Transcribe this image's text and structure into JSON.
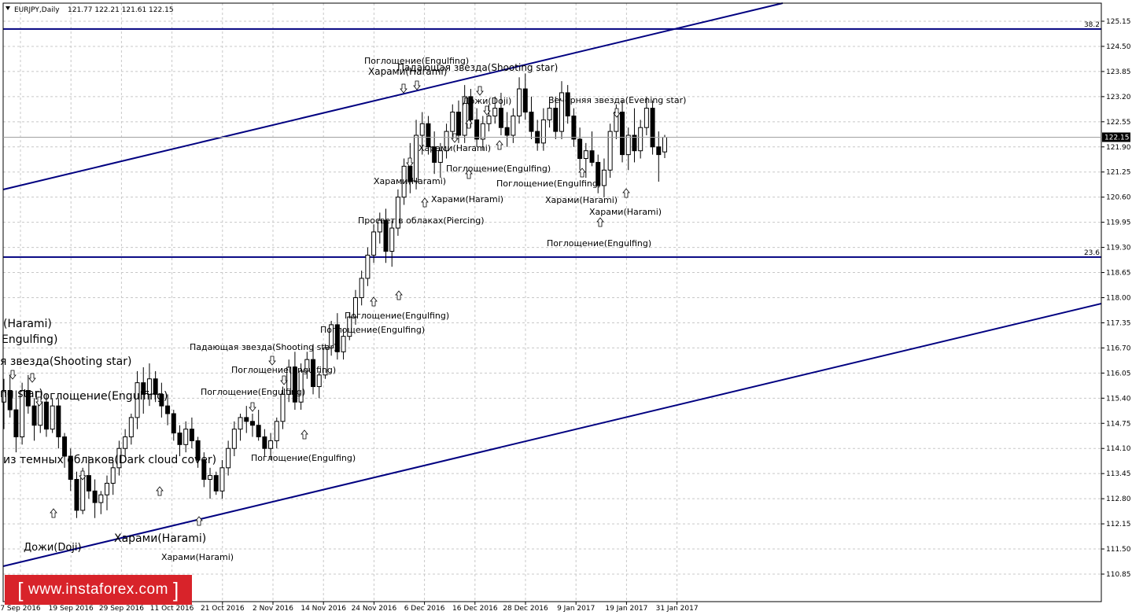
{
  "header": {
    "symbol": "EURJPY,Daily",
    "ohlc": "121.77 122.21 121.61 122.15"
  },
  "price_axis": {
    "ticks": [
      "125.15",
      "124.50",
      "123.85",
      "123.20",
      "122.55",
      "121.90",
      "121.25",
      "120.60",
      "119.95",
      "119.30",
      "118.65",
      "118.00",
      "117.35",
      "116.70",
      "116.05",
      "115.40",
      "114.75",
      "114.10",
      "113.45",
      "112.80",
      "112.15",
      "111.50",
      "110.85"
    ],
    "current_price": "122.15"
  },
  "time_axis": {
    "labels": [
      "7 Sep 2016",
      "19 Sep 2016",
      "29 Sep 2016",
      "11 Oct 2016",
      "21 Oct 2016",
      "2 Nov 2016",
      "14 Nov 2016",
      "24 Nov 2016",
      "6 Dec 2016",
      "16 Dec 2016",
      "28 Dec 2016",
      "9 Jan 2017",
      "19 Jan 2017",
      "31 Jan 2017"
    ]
  },
  "levels": [
    {
      "label": "38.2",
      "price": 124.95
    },
    {
      "label": "23.6",
      "price": 119.05
    }
  ],
  "pattern_labels": [
    "Поглощение(Engulfing)",
    "Падающая звезда(Shooting star)",
    "Харами(Harami)",
    "Дожи(Doji)",
    "Вечерняя звезда(Evening star)",
    "Харами(Harami)",
    "Поглощение(Engulfing)",
    "Харами(Harami)",
    "Поглощение(Engulfing)",
    "Харами(Harami)",
    "Харами(Harami)",
    "Просвет в облаках(Piercing)",
    "Харами(Harami)",
    "Поглощение(Engulfing)",
    "Поглощение(Engulfing)",
    "Поглощение(Engulfing)",
    "Падающая звезда(Shooting star)",
    "Поглощение(Engulfing)",
    "Поглощение(Engulfing)",
    "Поглощение(Engulfing)",
    "Харами(Harami)",
    "Харами(Harami)",
    "Дожи(Doji)",
    "из темных облаков(Dark cloud cover)",
    "Поглощение(Engulfing)",
    "ng star)",
    "я звезда(Shooting star)",
    "Engulfing)",
    "(Harami)"
  ],
  "watermark": {
    "text": "www.instaforex.com",
    "open": "[",
    "close": "]"
  },
  "colors": {
    "trend_line": "#000080",
    "bull_body": "#ffffff",
    "bear_body": "#000000",
    "grid": "#c8c8c8"
  },
  "chart_data": {
    "type": "candlestick",
    "symbol": "EURJPY",
    "timeframe": "Daily",
    "ylim": [
      110.6,
      125.5
    ],
    "x": [
      "7 Sep 2016",
      "19 Sep 2016",
      "29 Sep 2016",
      "11 Oct 2016",
      "21 Oct 2016",
      "2 Nov 2016",
      "14 Nov 2016",
      "24 Nov 2016",
      "6 Dec 2016",
      "16 Dec 2016",
      "28 Dec 2016",
      "9 Jan 2017",
      "19 Jan 2017",
      "31 Jan 2017"
    ],
    "series": [
      {
        "name": "EURJPY,Daily",
        "values": [
          [
            115.3,
            115.9,
            114.6,
            115.6
          ],
          [
            115.6,
            116.0,
            114.9,
            115.1
          ],
          [
            115.1,
            115.6,
            114.0,
            114.4
          ],
          [
            114.4,
            115.8,
            114.2,
            115.6
          ],
          [
            115.6,
            116.0,
            115.0,
            115.2
          ],
          [
            115.2,
            115.4,
            114.3,
            114.7
          ],
          [
            114.7,
            115.4,
            114.5,
            115.3
          ],
          [
            115.3,
            115.5,
            114.4,
            114.6
          ],
          [
            114.6,
            115.4,
            114.5,
            115.2
          ],
          [
            115.2,
            115.4,
            114.1,
            114.4
          ],
          [
            114.4,
            114.5,
            113.6,
            113.9
          ],
          [
            113.9,
            114.1,
            113.0,
            113.3
          ],
          [
            113.3,
            113.5,
            112.3,
            112.5
          ],
          [
            112.5,
            113.6,
            112.4,
            113.4
          ],
          [
            113.4,
            113.9,
            112.8,
            113.0
          ],
          [
            113.0,
            113.3,
            112.3,
            112.7
          ],
          [
            112.7,
            113.0,
            112.4,
            112.9
          ],
          [
            112.9,
            113.4,
            112.5,
            113.2
          ],
          [
            113.2,
            113.8,
            112.9,
            113.6
          ],
          [
            113.6,
            114.3,
            113.4,
            114.1
          ],
          [
            114.1,
            114.6,
            113.9,
            114.4
          ],
          [
            114.4,
            115.0,
            114.2,
            114.9
          ],
          [
            114.9,
            116.1,
            114.6,
            115.8
          ],
          [
            115.8,
            116.2,
            115.0,
            115.5
          ],
          [
            115.5,
            116.3,
            115.2,
            115.9
          ],
          [
            115.9,
            116.1,
            115.3,
            115.5
          ],
          [
            115.5,
            115.8,
            114.9,
            115.2
          ],
          [
            115.2,
            115.5,
            114.7,
            115.0
          ],
          [
            115.0,
            115.1,
            114.3,
            114.5
          ],
          [
            114.5,
            114.7,
            113.9,
            114.2
          ],
          [
            114.2,
            114.8,
            114.0,
            114.6
          ],
          [
            114.6,
            114.9,
            114.1,
            114.3
          ],
          [
            114.3,
            114.4,
            113.6,
            113.8
          ],
          [
            113.8,
            114.0,
            113.1,
            113.3
          ],
          [
            113.3,
            113.6,
            112.8,
            113.4
          ],
          [
            113.4,
            113.5,
            112.9,
            113.0
          ],
          [
            113.0,
            113.8,
            112.8,
            113.6
          ],
          [
            113.6,
            114.3,
            113.4,
            114.1
          ],
          [
            114.1,
            114.8,
            113.9,
            114.6
          ],
          [
            114.6,
            115.0,
            114.3,
            114.9
          ],
          [
            114.9,
            115.2,
            114.5,
            114.8
          ],
          [
            114.8,
            115.0,
            114.4,
            114.7
          ],
          [
            114.7,
            115.1,
            114.3,
            114.4
          ],
          [
            114.4,
            114.6,
            113.9,
            114.1
          ],
          [
            114.1,
            114.5,
            113.8,
            114.3
          ],
          [
            114.3,
            114.9,
            114.1,
            114.8
          ],
          [
            114.8,
            115.7,
            114.6,
            115.5
          ],
          [
            115.5,
            116.4,
            115.3,
            116.2
          ],
          [
            116.2,
            116.6,
            115.1,
            115.3
          ],
          [
            115.3,
            116.3,
            115.1,
            116.1
          ],
          [
            116.1,
            116.6,
            115.9,
            116.4
          ],
          [
            116.4,
            116.8,
            115.5,
            115.7
          ],
          [
            115.7,
            116.1,
            115.4,
            116.0
          ],
          [
            116.0,
            116.8,
            115.9,
            116.7
          ],
          [
            116.7,
            117.4,
            116.5,
            117.3
          ],
          [
            117.3,
            117.6,
            116.4,
            116.6
          ],
          [
            116.6,
            117.2,
            116.4,
            117.0
          ],
          [
            117.0,
            117.6,
            116.9,
            117.5
          ],
          [
            117.5,
            118.2,
            117.3,
            118.0
          ],
          [
            118.0,
            118.7,
            117.8,
            118.5
          ],
          [
            118.5,
            119.3,
            118.3,
            119.1
          ],
          [
            119.1,
            119.9,
            118.9,
            119.7
          ],
          [
            119.7,
            120.2,
            119.4,
            120.0
          ],
          [
            120.0,
            120.3,
            118.9,
            119.2
          ],
          [
            119.2,
            120.0,
            118.8,
            119.8
          ],
          [
            119.8,
            120.8,
            119.6,
            120.6
          ],
          [
            120.6,
            121.6,
            120.4,
            121.4
          ],
          [
            121.4,
            122.0,
            120.7,
            121.0
          ],
          [
            121.0,
            122.6,
            120.8,
            122.2
          ],
          [
            122.2,
            122.8,
            121.7,
            122.5
          ],
          [
            122.5,
            122.7,
            121.7,
            121.9
          ],
          [
            121.9,
            122.3,
            121.2,
            121.5
          ],
          [
            121.5,
            122.0,
            121.1,
            121.8
          ],
          [
            121.8,
            122.5,
            121.6,
            122.3
          ],
          [
            122.3,
            123.0,
            122.1,
            122.8
          ],
          [
            122.8,
            123.1,
            122.0,
            122.2
          ],
          [
            122.2,
            123.5,
            122.0,
            123.2
          ],
          [
            123.2,
            123.4,
            122.4,
            122.6
          ],
          [
            122.6,
            122.9,
            121.9,
            122.1
          ],
          [
            122.1,
            122.7,
            121.8,
            122.5
          ],
          [
            122.5,
            123.0,
            122.3,
            122.7
          ],
          [
            122.7,
            123.2,
            122.5,
            122.9
          ],
          [
            122.9,
            123.3,
            122.2,
            122.4
          ],
          [
            122.4,
            122.8,
            121.9,
            122.2
          ],
          [
            122.2,
            122.9,
            122.0,
            122.7
          ],
          [
            122.7,
            123.7,
            122.5,
            123.4
          ],
          [
            123.4,
            123.8,
            122.6,
            122.8
          ],
          [
            122.8,
            123.2,
            122.1,
            122.3
          ],
          [
            122.3,
            122.6,
            121.8,
            122.0
          ],
          [
            122.0,
            122.9,
            121.8,
            122.6
          ],
          [
            122.6,
            123.1,
            122.4,
            122.9
          ],
          [
            122.9,
            123.2,
            122.1,
            122.3
          ],
          [
            122.3,
            123.6,
            122.1,
            123.3
          ],
          [
            123.3,
            123.5,
            122.5,
            122.7
          ],
          [
            122.7,
            122.9,
            121.9,
            122.1
          ],
          [
            122.1,
            122.4,
            121.3,
            121.6
          ],
          [
            121.6,
            122.0,
            121.1,
            121.8
          ],
          [
            121.8,
            122.3,
            121.4,
            121.5
          ],
          [
            121.5,
            121.7,
            120.7,
            120.9
          ],
          [
            120.9,
            121.6,
            120.6,
            121.3
          ],
          [
            121.3,
            122.5,
            121.1,
            122.3
          ],
          [
            122.3,
            123.0,
            122.1,
            122.8
          ],
          [
            122.8,
            123.1,
            121.5,
            121.7
          ],
          [
            121.7,
            122.4,
            121.3,
            122.2
          ],
          [
            122.2,
            122.9,
            121.5,
            121.8
          ],
          [
            121.8,
            122.6,
            121.6,
            122.4
          ],
          [
            122.4,
            123.2,
            122.2,
            122.9
          ],
          [
            122.9,
            123.1,
            121.7,
            121.9
          ],
          [
            121.9,
            122.3,
            121.0,
            121.7
          ],
          [
            121.77,
            122.21,
            121.61,
            122.15
          ]
        ]
      }
    ]
  }
}
